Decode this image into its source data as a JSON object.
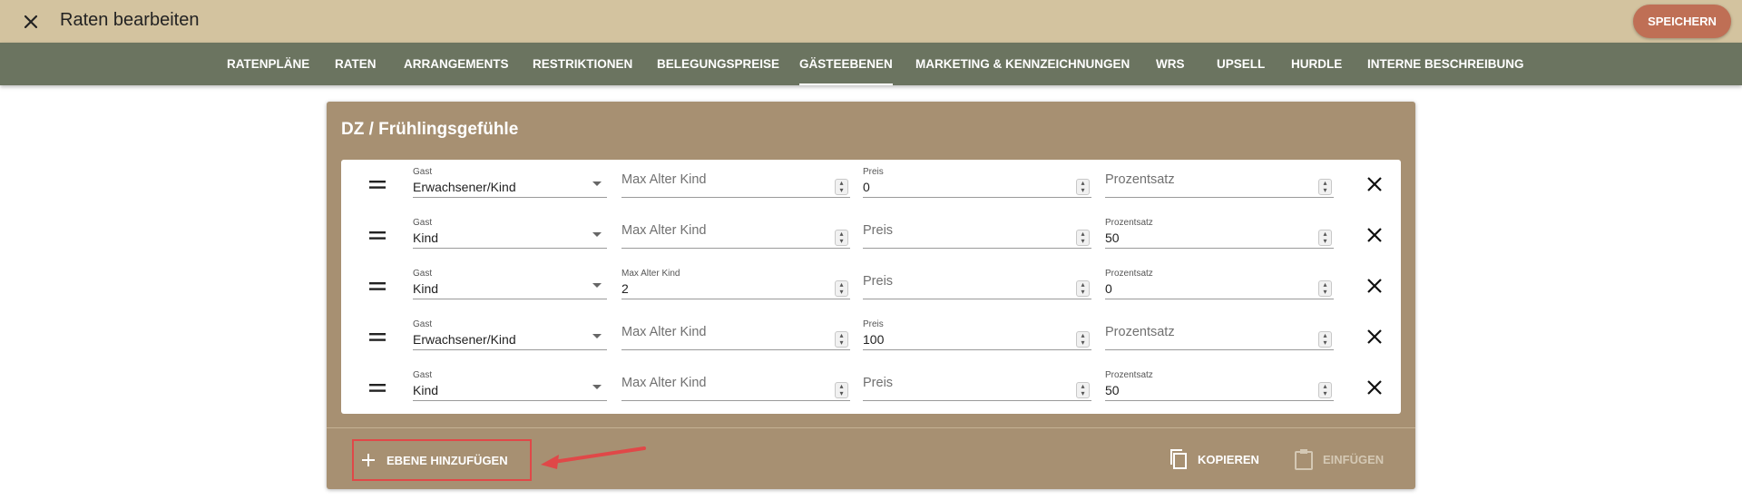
{
  "header": {
    "title": "Raten bearbeiten",
    "save_label": "SPEICHERN"
  },
  "tabs": [
    {
      "label": "RATENPLÄNE",
      "active": false
    },
    {
      "label": "RATEN",
      "active": false
    },
    {
      "label": "ARRANGEMENTS",
      "active": false
    },
    {
      "label": "RESTRIKTIONEN",
      "active": false
    },
    {
      "label": "BELEGUNGSPREISE",
      "active": false
    },
    {
      "label": "GÄSTEEBENEN",
      "active": true
    },
    {
      "label": "MARKETING & KENNZEICHNUNGEN",
      "active": false
    },
    {
      "label": "WRS",
      "active": false
    },
    {
      "label": "UPSELL",
      "active": false
    },
    {
      "label": "HURDLE",
      "active": false
    },
    {
      "label": "INTERNE BESCHREIBUNG",
      "active": false
    }
  ],
  "card": {
    "title": "DZ / Frühlingsgefühle",
    "field_labels": {
      "guest": "Gast",
      "max_age": "Max Alter Kind",
      "price": "Preis",
      "percent": "Prozentsatz"
    },
    "rows": [
      {
        "guest": "Erwachsener/Kind",
        "max_age": "",
        "price": "0",
        "percent": ""
      },
      {
        "guest": "Kind",
        "max_age": "",
        "price": "",
        "percent": "50"
      },
      {
        "guest": "Kind",
        "max_age": "2",
        "price": "",
        "percent": "0"
      },
      {
        "guest": "Erwachsener/Kind",
        "max_age": "",
        "price": "100",
        "percent": ""
      },
      {
        "guest": "Kind",
        "max_age": "",
        "price": "",
        "percent": "50"
      }
    ],
    "add_label": "EBENE HINZUFÜGEN",
    "copy_label": "KOPIEREN",
    "paste_label": "EINFÜGEN"
  },
  "colors": {
    "topbar": "#d3c39f",
    "navbar": "#6b7460",
    "card": "#a79072",
    "save": "#bf6f55",
    "highlight": "#e04848"
  },
  "icons": [
    "close-icon",
    "drag-handle-icon",
    "chevron-down-icon",
    "spinner-icon",
    "delete-icon",
    "plus-icon",
    "copy-icon",
    "paste-icon",
    "arrow-icon"
  ]
}
